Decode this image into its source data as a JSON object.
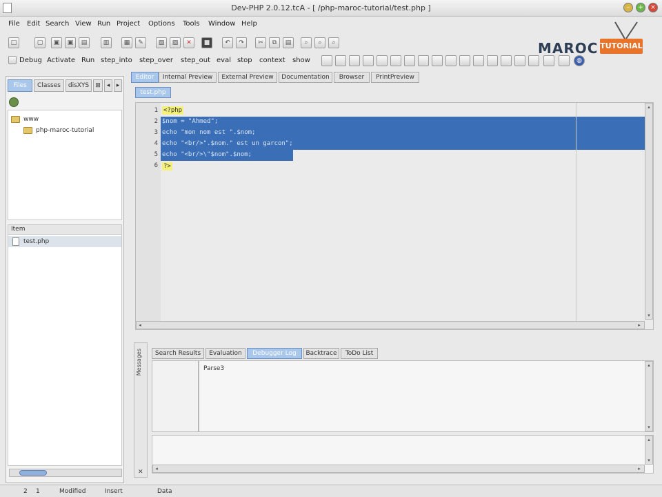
{
  "window": {
    "title": "Dev-PHP 2.0.12.tcA - [ /php-maroc-tutorial/test.php ]"
  },
  "menu": [
    "File",
    "Edit",
    "Search",
    "View",
    "Run",
    "Project",
    "Options",
    "Tools",
    "Window",
    "Help"
  ],
  "debug_toolbar": {
    "items": [
      "Debug",
      "Activate",
      "Run",
      "step_into",
      "step_over",
      "step_out",
      "eval",
      "stop",
      "context",
      "show"
    ]
  },
  "logo": {
    "text": "MAROC",
    "badge": "TUTORIAL"
  },
  "left_panel": {
    "tabs": [
      "Files",
      "Classes",
      "disXYS"
    ],
    "tree": [
      {
        "label": "www"
      },
      {
        "label": "php-maroc-tutorial"
      }
    ],
    "files_header": "Item",
    "files": [
      "test.php"
    ]
  },
  "editor": {
    "tabs": [
      "Editor",
      "Internal Preview",
      "External Preview",
      "Documentation",
      "Browser",
      "PrintPreview"
    ],
    "file_tab": "test.php",
    "lines": [
      {
        "num": "1",
        "text": "<?php"
      },
      {
        "num": "2",
        "text": "$nom = \"Ahmed\";"
      },
      {
        "num": "3",
        "text": "echo \"mon nom est \".$nom;"
      },
      {
        "num": "4",
        "text": "echo \"<br/>\".$nom.\" est un garcon\";"
      },
      {
        "num": "5",
        "text": "echo \"<br/>\\\"$nom\".$nom;"
      },
      {
        "num": "6",
        "text": "?>"
      }
    ]
  },
  "bottom_panel": {
    "side_label": "Messages",
    "tabs": [
      "Search Results",
      "Evaluation",
      "Debugger Log",
      "Backtrace",
      "ToDo List"
    ],
    "log_text": "Parse3"
  },
  "statusbar": {
    "line": "2",
    "col": "1",
    "modified": "Modified",
    "mode": "Insert",
    "extra": "Data"
  }
}
